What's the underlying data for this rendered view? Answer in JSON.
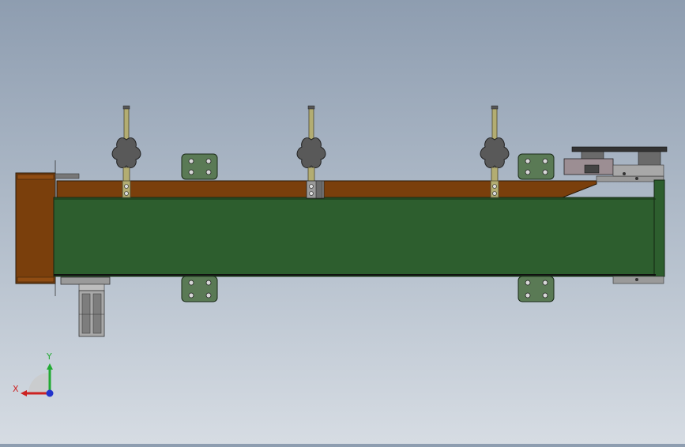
{
  "viewport": {
    "background_top": "#8e9db0",
    "background_bottom": "#d6dce3"
  },
  "model": {
    "belt_color": "#2d5e2e",
    "frame_color": "#7a3f0c",
    "bracket_color": "#5a7a55",
    "knob_color": "#555555",
    "rod_color": "#b3ad72"
  },
  "triad": {
    "x_label": "X",
    "y_label": "Y",
    "x_color": "#cc2222",
    "y_color": "#22aa33",
    "z_color": "#2233cc"
  }
}
